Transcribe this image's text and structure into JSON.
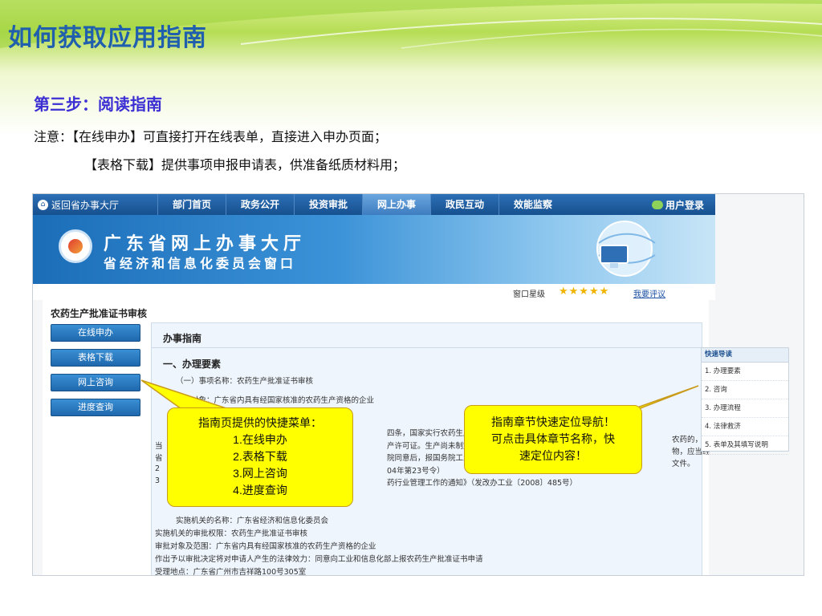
{
  "slide": {
    "title": "如何获取应用指南",
    "step_title": "第三步：阅读指南",
    "note_line1": "注意：【在线申办】可直接打开在线表单，直接进入申办页面；",
    "note_line2": "【表格下载】提供事项申报申请表，供准备纸质材料用；"
  },
  "portal": {
    "back_link": "返回省办事大厅",
    "nav_items": [
      "部门首页",
      "政务公开",
      "投资审批",
      "网上办事",
      "政民互动",
      "效能监察"
    ],
    "active_nav": "网上办事",
    "login": "用户登录",
    "banner_line1": "广东省网上办事大厅",
    "banner_line2": "省经济和信息化委员会窗口",
    "rating_label": "窗口星级",
    "stars": "★★★★★",
    "rate_link": "我要评议",
    "page_heading": "农药生产批准证书审核",
    "side_buttons": [
      "在线申办",
      "表格下载",
      "网上咨询",
      "进度查询"
    ],
    "guide": {
      "title": "办事指南",
      "section": "一、办理要素",
      "items": [
        "（一）事项名称：农药生产批准证书审核",
        "办理对象：广东省内具有经国家核准的农药生产资格的企业",
        "四条，国家实行农药生产许",
        "产许可证。生产尚未制定",
        "院同意后，报国务院工业产",
        "04年第23号令）",
        "药行业管理工作的通知》（发改办工业〔2008〕485号）",
        "农药的，应",
        "物，应当经",
        "文件。",
        "实施机关的名称：广东省经济和信息化委员会",
        "实施机关的审批权限：农药生产批准证书审核",
        "审批对象及范围：广东省内具有经国家核准的农药生产资格的企业",
        "作出予以审批决定将对申请人产生的法律效力：同意向工业和信息化部上报农药生产批准证书申请",
        "受理地点：广东省广州市吉祥路100号305室"
      ],
      "left_fragments": [
        "当",
        "省",
        "2",
        "3"
      ]
    },
    "quick_nav": {
      "title": "快速导读",
      "items": [
        "1. 办理要素",
        "2. 咨询",
        "3. 办理流程",
        "4. 法律救济",
        "5. 表单及其填写说明"
      ]
    }
  },
  "callouts": {
    "left": [
      "指南页提供的快捷菜单：",
      "1.在线申办",
      "2.表格下载",
      "3.网上咨询",
      "4.进度查询"
    ],
    "right": [
      "指南章节快速定位导航！",
      "可点击具体章节名称，快",
      "速定位内容！"
    ]
  },
  "colors": {
    "title": "#1f5fae",
    "step_title": "#3b2fd4",
    "nav": "#16508f",
    "callout_fill": "#ffff00",
    "callout_border": "#c99b1a"
  }
}
